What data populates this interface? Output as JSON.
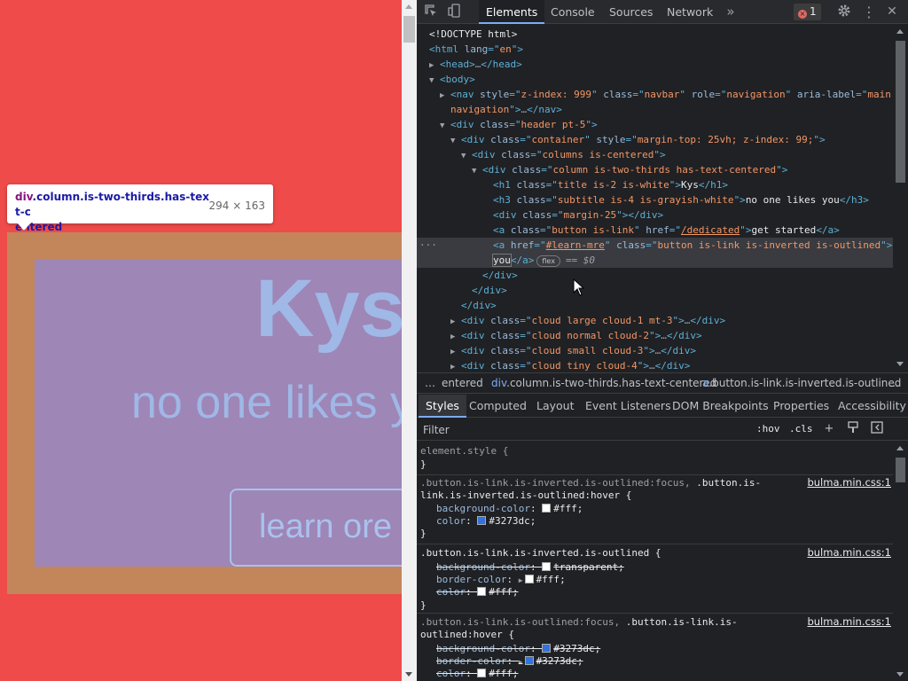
{
  "page": {
    "title": "Kys",
    "subtitle": "no one likes you",
    "button_label": "learn ore",
    "tooltip": {
      "tag": "div",
      "classes": ".column.is-two-thirds.has-text-c",
      "classes_wrap": "entered",
      "size": "294 × 163"
    }
  },
  "devtools": {
    "tabs": [
      "Elements",
      "Console",
      "Sources",
      "Network"
    ],
    "more_tabs_icon": "double-chevron-icon",
    "error_count": "1",
    "dom": {
      "doctype": "<!DOCTYPE html>",
      "html_lang": "en",
      "nav_style": "z-index: 999",
      "nav_class": "navbar",
      "nav_role": "navigation",
      "nav_aria": "main",
      "nav_aria_wrap": "navigation",
      "header_class": "header pt-5",
      "container_class": "container",
      "container_style": "margin-top: 25vh; z-index: 99;",
      "columns_class": "columns is-centered",
      "column_class": "column is-two-thirds has-text-centered",
      "h1_class": "title is-2 is-white",
      "h1_text": "Kys",
      "h3_class": "subtitle is-4 is-grayish-white",
      "h3_text": "no one likes you",
      "margin_class": "margin-25",
      "a1_class": "button is-link",
      "a1_href": "/dedicated",
      "a1_text": "get started",
      "a2_href": "#learn-mre",
      "a2_class": "button is-link is-inverted is-outlined",
      "a2_text": "you",
      "flex_badge": "flex",
      "dollar": "== $0",
      "cloud1_class": "cloud large cloud-1 mt-3",
      "cloud2_class": "cloud normal cloud-2",
      "cloud3_class": "cloud small cloud-3",
      "cloud4_class": "cloud tiny cloud-4"
    },
    "breadcrumbs": {
      "lead": "…",
      "item1": "entered",
      "item2_tag": "div",
      "item2_rest": ".column.is-two-thirds.has-text-centered",
      "item3_tag": "a",
      "item3_rest": ".button.is-link.is-inverted.is-outlined",
      "trail": "…"
    },
    "panel_tabs": [
      "Styles",
      "Computed",
      "Layout",
      "Event Listeners",
      "DOM Breakpoints",
      "Properties",
      "Accessibility"
    ],
    "filter_placeholder": "Filter",
    "hov": ":hov",
    "cls": ".cls",
    "rules": [
      {
        "selector_line1": "element.style {",
        "closing": "}"
      },
      {
        "selector_dim1": ".button.is-link.is-inverted.is-outlined:focus,",
        "selector_bright1": " .button.is-",
        "selector_line2": "link.is-inverted.is-outlined:hover {",
        "source": "bulma.min.css:1",
        "decls": [
          {
            "prop": "background-color",
            "value": "#fff",
            "swatch": "#ffffff",
            "struck": false
          },
          {
            "prop": "color",
            "value": "#3273dc",
            "swatch": "#3273dc",
            "struck": false
          }
        ],
        "closing": "}"
      },
      {
        "selector_line1": ".button.is-link.is-inverted.is-outlined {",
        "source": "bulma.min.css:1",
        "decls": [
          {
            "prop": "background-color",
            "value": "transparent",
            "swatch": "#ffffff",
            "struck": true
          },
          {
            "prop": "border-color",
            "value": "#fff",
            "swatch": "#ffffff",
            "struck": false,
            "expander": true
          },
          {
            "prop": "color",
            "value": "#fff",
            "swatch": "#ffffff",
            "struck": true
          }
        ],
        "closing": "}"
      },
      {
        "selector_dim1": ".button.is-link.is-outlined:focus,",
        "selector_bright1": " .button.is-link.is-",
        "selector_line2": "outlined:hover {",
        "source": "bulma.min.css:1",
        "decls": [
          {
            "prop": "background-color",
            "value": "#3273dc",
            "swatch": "#3273dc",
            "struck": true
          },
          {
            "prop": "border-color",
            "value": "#3273dc",
            "swatch": "#3273dc",
            "struck": true,
            "expander": true
          },
          {
            "prop": "color",
            "value": "#fff",
            "swatch": "#ffffff",
            "struck": true
          }
        ]
      }
    ]
  },
  "colors": {
    "page_bg": "#ef4b4b",
    "devtools_bg": "#202124",
    "accent": "#7cacf8",
    "highlight_margin": "#bf8b5b",
    "highlight_content": "#9e86b7"
  }
}
